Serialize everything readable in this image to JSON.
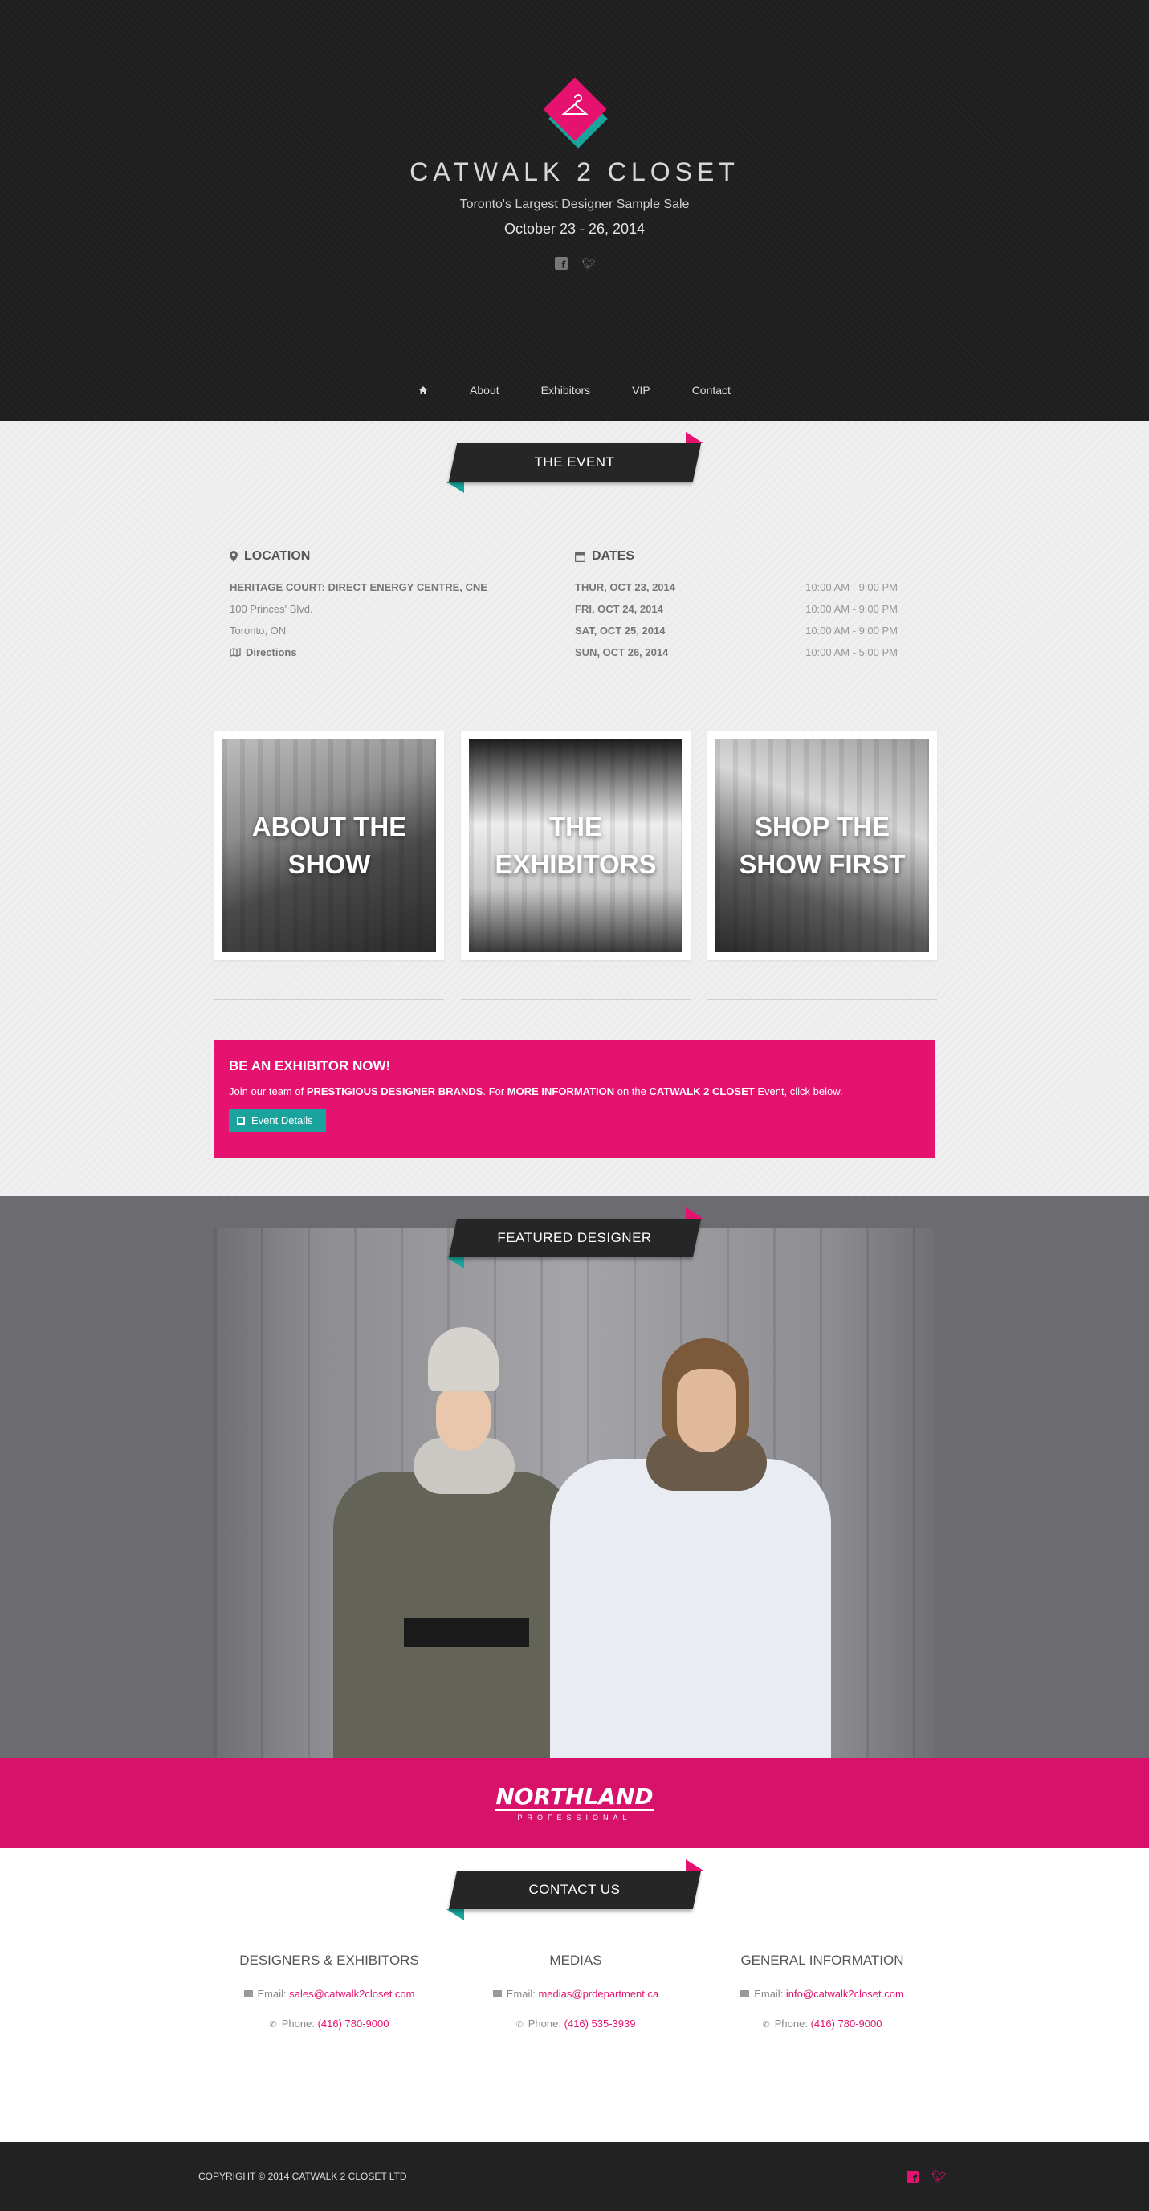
{
  "brand": {
    "title": "CATWALK 2 CLOSET",
    "tagline": "Toronto's Largest Designer Sample Sale",
    "dates": "October 23 - 26, 2014",
    "pink": "#e5136f",
    "teal": "#1aa39c"
  },
  "nav": {
    "items": [
      "About",
      "Exhibitors",
      "VIP",
      "Contact"
    ]
  },
  "event": {
    "ribbon": "THE EVENT",
    "location": {
      "heading": "LOCATION",
      "venue": "HERITAGE COURT: DIRECT ENERGY CENTRE, CNE",
      "street": "100 Princes' Blvd.",
      "city": "Toronto, ON",
      "directions": "Directions"
    },
    "dates": {
      "heading": "DATES",
      "rows": [
        {
          "day": "THUR, OCT 23, 2014",
          "time": "10:00 AM - 9:00 PM"
        },
        {
          "day": "FRI, OCT 24, 2014",
          "time": "10:00 AM - 9:00 PM"
        },
        {
          "day": "SAT, OCT 25, 2014",
          "time": "10:00 AM - 9:00 PM"
        },
        {
          "day": "SUN, OCT 26, 2014",
          "time": "10:00 AM - 5:00 PM"
        }
      ]
    },
    "tiles": [
      "ABOUT THE SHOW",
      "THE EXHIBITORS",
      "SHOP THE SHOW FIRST"
    ],
    "cta": {
      "heading": "BE AN EXHIBITOR NOW!",
      "text_1": "Join our team of ",
      "bold_1": "PRESTIGIOUS DESIGNER BRANDS",
      "text_2": ". For ",
      "bold_2": "MORE INFORMATION",
      "text_3": " on the ",
      "bold_3": "CATWALK 2 CLOSET",
      "text_4": " Event, click below.",
      "button": "Event Details"
    }
  },
  "featured": {
    "ribbon": "FEATURED DESIGNER",
    "brand_name": "NORTHLAND",
    "brand_sub": "PROFESSIONAL"
  },
  "contact": {
    "ribbon": "CONTACT US",
    "columns": [
      {
        "title": "DESIGNERS & EXHIBITORS",
        "email_label": "Email: ",
        "email": "sales@catwalk2closet.com",
        "phone_label": "Phone: ",
        "phone": "(416) 780-9000"
      },
      {
        "title": "MEDIAS",
        "email_label": "Email: ",
        "email": "medias@prdepartment.ca",
        "phone_label": "Phone: ",
        "phone": "(416) 535-3939"
      },
      {
        "title": "GENERAL INFORMATION",
        "email_label": "Email: ",
        "email": "info@catwalk2closet.com",
        "phone_label": "Phone: ",
        "phone": "(416) 780-9000"
      }
    ]
  },
  "footer": {
    "copyright": "COPYRIGHT © 2014 CATWALK 2 CLOSET LTD"
  }
}
